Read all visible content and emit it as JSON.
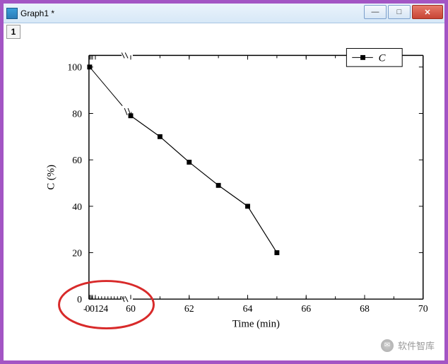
{
  "window": {
    "title": "Graph1 *",
    "minimize_label": "—",
    "maximize_label": "□",
    "close_label": "✕"
  },
  "tab_label": "1",
  "legend": {
    "entry": "C",
    "marker": "square"
  },
  "watermark": "软件智库",
  "chart_data": {
    "type": "line",
    "title": "",
    "xlabel": "Time (min)",
    "ylabel": "C (%)",
    "x_axis_break": true,
    "x_segment1": {
      "range": [
        -0.5,
        24
      ],
      "ticks": [
        0,
        1,
        2,
        4
      ]
    },
    "x_segment2": {
      "range": [
        60,
        70
      ],
      "ticks": [
        60,
        62,
        64,
        66,
        68,
        70
      ]
    },
    "y_range": [
      0,
      105
    ],
    "y_ticks": [
      0,
      20,
      40,
      60,
      80,
      100
    ],
    "series": [
      {
        "name": "C",
        "points": [
          {
            "x": 0,
            "y": 100
          },
          {
            "x": 60,
            "y": 79
          },
          {
            "x": 61,
            "y": 70
          },
          {
            "x": 62,
            "y": 59
          },
          {
            "x": 63,
            "y": 49
          },
          {
            "x": 64,
            "y": 40
          },
          {
            "x": 65,
            "y": 20
          }
        ]
      }
    ],
    "annotation": {
      "type": "red-ellipse",
      "description": "circled compressed x tick region near origin"
    }
  }
}
